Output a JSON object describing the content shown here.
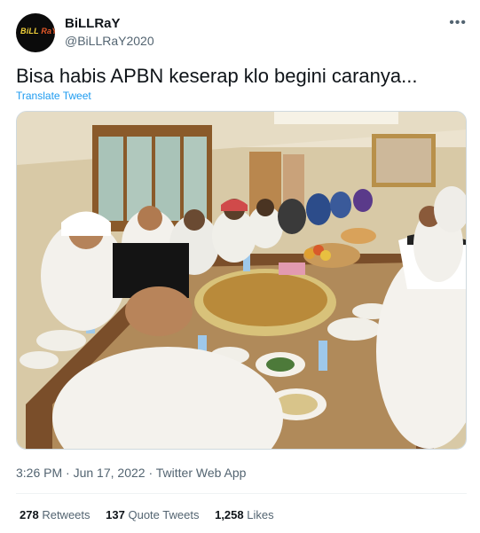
{
  "user": {
    "display_name": "BiLLRaY",
    "handle": "@BiLLRaY2020",
    "avatar_text_a": "BiLL ",
    "avatar_text_b": "RaY"
  },
  "more_icon": "more-dots-icon",
  "tweet": {
    "text": "Bisa habis APBN keserap klo begini caranya...",
    "translate_label": "Translate Tweet"
  },
  "meta": {
    "time": "3:26 PM",
    "sep1": " · ",
    "date": "Jun 17, 2022",
    "sep2": " · ",
    "app": "Twitter Web App"
  },
  "stats": {
    "retweets_count": "278",
    "retweets_label": "Retweets",
    "quotes_count": "137",
    "quotes_label": "Quote Tweets",
    "likes_count": "1,258",
    "likes_label": "Likes"
  },
  "colors": {
    "accent": "#1d9bf0",
    "text": "#0f1419",
    "muted": "#536471"
  }
}
